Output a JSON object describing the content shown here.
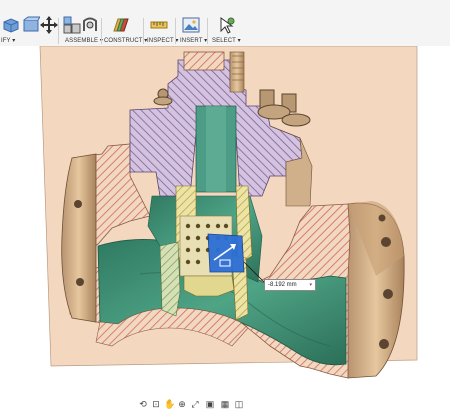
{
  "toolbar": {
    "groups": [
      {
        "label": "IFY ▾"
      },
      {
        "label": "ASSEMBLE ▾"
      },
      {
        "label": "CONSTRUCT ▾"
      },
      {
        "label": "INSPECT ▾"
      },
      {
        "label": "INSERT ▾"
      },
      {
        "label": "SELECT ▾"
      }
    ]
  },
  "measurement": {
    "value": "-8.192 mm",
    "unit_icon": "▾"
  },
  "navbar": {
    "items": [
      "orbit-icon",
      "look-at-icon",
      "pan-icon",
      "zoom-icon",
      "fit-icon",
      "display-settings-icon",
      "grid-icon",
      "viewports-icon"
    ]
  },
  "colors": {
    "section_plane": "#f3d7be",
    "metal_outer": "#d9b68f",
    "interior_green": "#3b8f73",
    "bonnet_purple": "#c9b6d6",
    "cage_yellow": "#e2d78e",
    "selected_blue": "#2d6fd6"
  }
}
